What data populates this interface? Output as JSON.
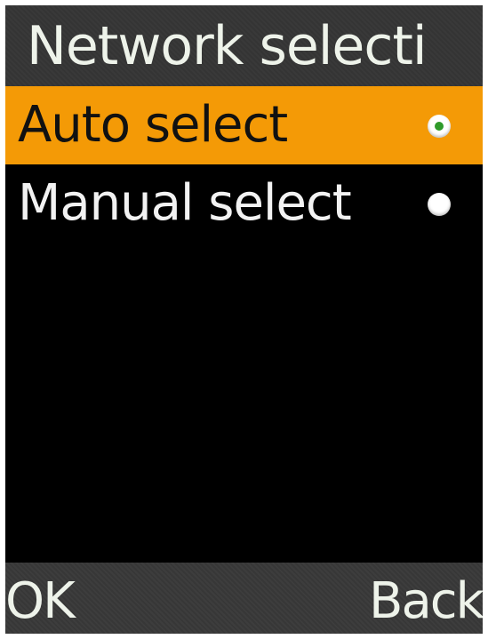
{
  "header": {
    "title": "Network selecti"
  },
  "options": [
    {
      "label": "Auto select",
      "selected": true
    },
    {
      "label": "Manual select",
      "selected": false
    }
  ],
  "softkeys": {
    "left": "OK",
    "right": "Back"
  },
  "colors": {
    "highlight": "#f49a06",
    "radio_dot": "#2f9a2a",
    "background": "#000000",
    "bar": "#343434"
  }
}
